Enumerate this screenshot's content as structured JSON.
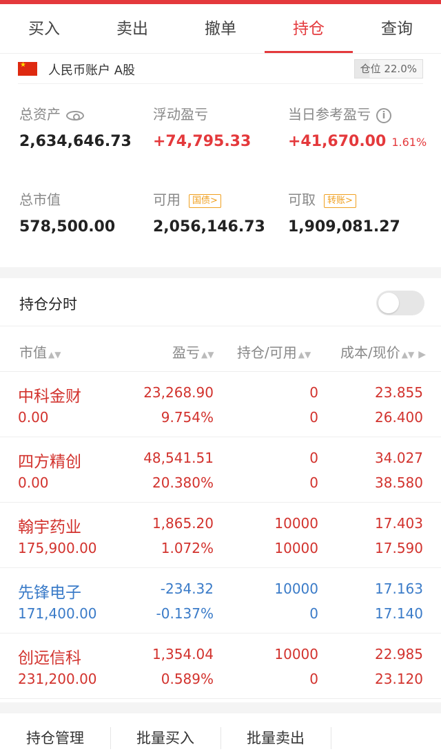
{
  "tabs": [
    "买入",
    "卖出",
    "撤单",
    "持仓",
    "查询"
  ],
  "account": {
    "name": "人民币账户 A股",
    "position_ratio": "仓位 22.0%"
  },
  "metrics": {
    "total_assets_label": "总资产",
    "total_assets": "2,634,646.73",
    "float_pl_label": "浮动盈亏",
    "float_pl": "+74,795.33",
    "daily_pl_label": "当日参考盈亏",
    "daily_pl": "+41,670.00",
    "daily_pl_pct": "1.61%",
    "market_value_label": "总市值",
    "market_value": "578,500.00",
    "available_label": "可用",
    "available_tag": "国债>",
    "available": "2,056,146.73",
    "withdrawable_label": "可取",
    "withdrawable_tag": "转账>",
    "withdrawable": "1,909,081.27"
  },
  "holdings_section": {
    "title": "持仓分时"
  },
  "columns": {
    "market_value": "市值",
    "pl": "盈亏",
    "position": "持仓/可用",
    "cost_price": "成本/现价"
  },
  "rows": [
    {
      "name": "中科金财",
      "mv": "0.00",
      "pl": "23,268.90",
      "pl_pct": "9.754%",
      "pos": "0",
      "avail": "0",
      "cost": "23.855",
      "price": "26.400",
      "color": "red"
    },
    {
      "name": "四方精创",
      "mv": "0.00",
      "pl": "48,541.51",
      "pl_pct": "20.380%",
      "pos": "0",
      "avail": "0",
      "cost": "34.027",
      "price": "38.580",
      "color": "red"
    },
    {
      "name": "翰宇药业",
      "mv": "175,900.00",
      "pl": "1,865.20",
      "pl_pct": "1.072%",
      "pos": "10000",
      "avail": "10000",
      "cost": "17.403",
      "price": "17.590",
      "color": "red"
    },
    {
      "name": "先锋电子",
      "mv": "171,400.00",
      "pl": "-234.32",
      "pl_pct": "-0.137%",
      "pos": "10000",
      "avail": "0",
      "cost": "17.163",
      "price": "17.140",
      "color": "blue"
    },
    {
      "name": "创远信科",
      "mv": "231,200.00",
      "pl": "1,354.04",
      "pl_pct": "0.589%",
      "pos": "10000",
      "avail": "0",
      "cost": "22.985",
      "price": "23.120",
      "color": "red"
    }
  ],
  "bottom_actions": [
    "持仓管理",
    "批量买入",
    "批量卖出"
  ]
}
